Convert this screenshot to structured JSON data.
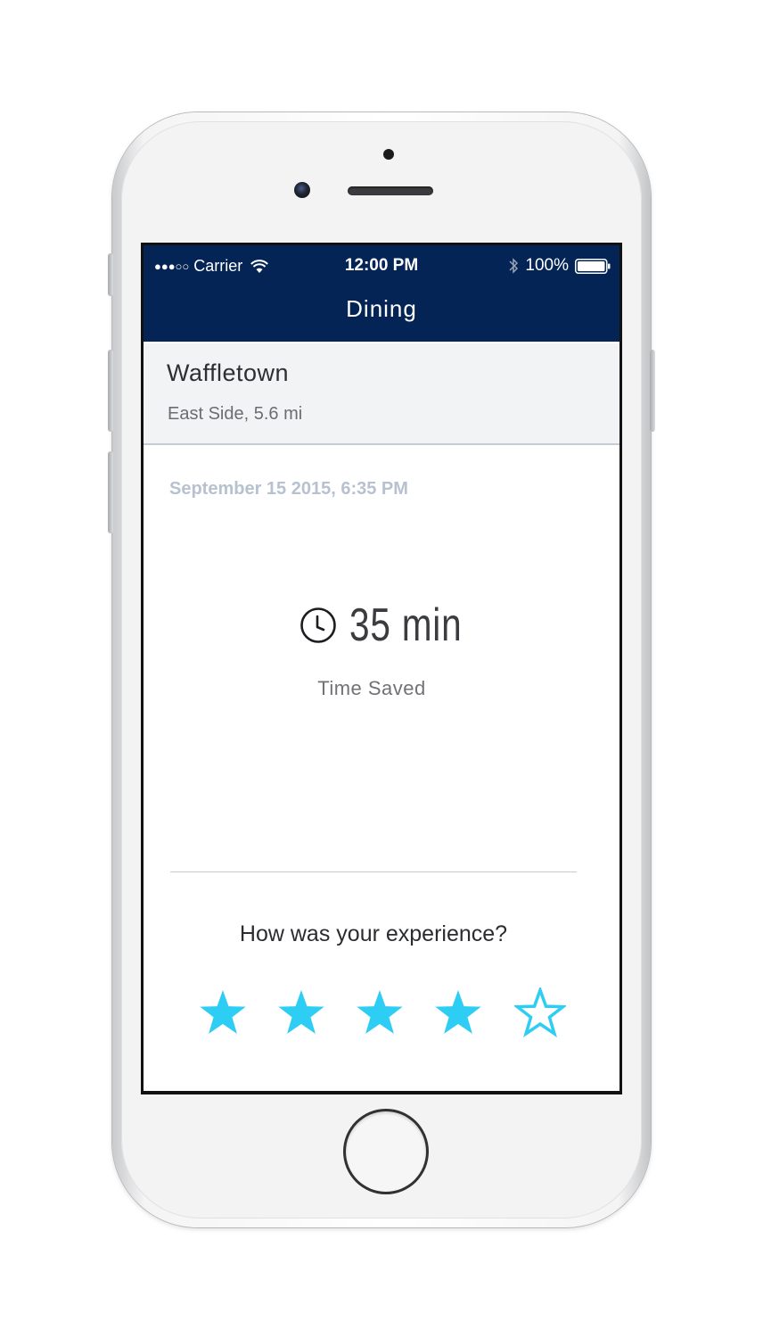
{
  "status_bar": {
    "signal": "●●●○○",
    "carrier": "Carrier",
    "time": "12:00 PM",
    "battery": "100%"
  },
  "nav": {
    "title": "Dining"
  },
  "venue": {
    "name": "Waffletown",
    "location": "East Side, 5.6 mi"
  },
  "visit": {
    "date": "September 15 2015, 6:35 PM",
    "time_saved_value": "35 min",
    "time_saved_label": "Time Saved"
  },
  "feedback": {
    "question": "How was your experience?",
    "rating": 4,
    "max_rating": 5
  },
  "colors": {
    "navbar": "#042455",
    "star": "#2ecdf3",
    "date_text": "#b8c1cf"
  },
  "icons": [
    "signal-icon",
    "wifi-icon",
    "bluetooth-icon",
    "battery-icon",
    "clock-icon",
    "star-icon"
  ]
}
